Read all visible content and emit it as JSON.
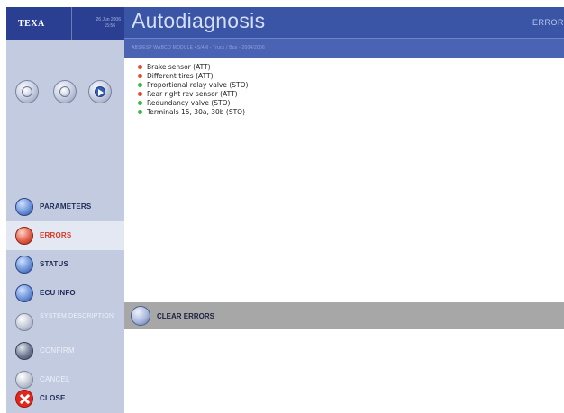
{
  "brand": {
    "logo_text": "TEXA",
    "date": "26 Jun 2006",
    "time": "15:56"
  },
  "header": {
    "title": "Autodiagnosis",
    "section": "ERROR",
    "subtitle": "ABS/ESP WABCO MODULE 4S/4M - Truck / Bus - 2004/2006"
  },
  "nav_icons": [
    {
      "name": "print-icon"
    },
    {
      "name": "record-icon"
    },
    {
      "name": "next-icon"
    }
  ],
  "menu": [
    {
      "id": "parameters",
      "label": "PARAMETERS",
      "icon": "parameters-icon",
      "state": "normal"
    },
    {
      "id": "errors",
      "label": "ERRORS",
      "icon": "errors-icon",
      "state": "active"
    },
    {
      "id": "status",
      "label": "STATUS",
      "icon": "status-icon",
      "state": "normal"
    },
    {
      "id": "ecu-info",
      "label": "ECU INFO",
      "icon": "ecu-info-icon",
      "state": "normal"
    },
    {
      "id": "system-description",
      "label": "SYSTEM DESCRIPTION",
      "icon": "system-description-icon",
      "state": "disabled"
    },
    {
      "id": "confirm",
      "label": "CONFIRM",
      "icon": "check-icon",
      "state": "disabled"
    },
    {
      "id": "cancel",
      "label": "CANCEL",
      "icon": "cancel-icon",
      "state": "disabled"
    },
    {
      "id": "close",
      "label": "CLOSE",
      "icon": "close-icon",
      "state": "normal"
    }
  ],
  "errors": [
    {
      "text": "Brake sensor (ATT)",
      "status_color": "#e5472f"
    },
    {
      "text": "Different tires (ATT)",
      "status_color": "#e5472f"
    },
    {
      "text": "Proportional relay valve (STO)",
      "status_color": "#3bb54a"
    },
    {
      "text": "Rear right rev sensor (ATT)",
      "status_color": "#e5472f"
    },
    {
      "text": "Redundancy valve (STO)",
      "status_color": "#3bb54a"
    },
    {
      "text": "Terminals 15, 30a, 30b (STO)",
      "status_color": "#3bb54a"
    }
  ],
  "clear_button": {
    "label": "CLEAR ERRORS"
  },
  "colors": {
    "header_blue": "#3a54a6",
    "sidebar_bg": "#c3cbe1",
    "error_red": "#e5472f",
    "stored_green": "#3bb54a",
    "clear_bar_grey": "#a7a7a7"
  }
}
